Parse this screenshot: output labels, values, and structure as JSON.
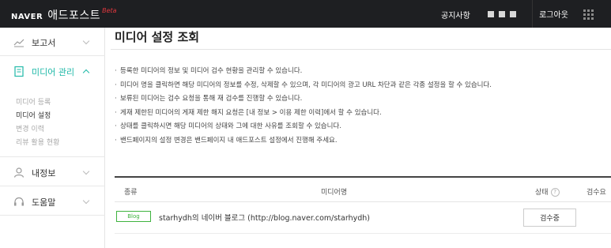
{
  "header": {
    "brand": "NAVER",
    "product": "애드포스트",
    "beta": "Beta",
    "notice": "공지사항",
    "logout": "로그아웃"
  },
  "sidebar": {
    "items": [
      {
        "label": "보고서",
        "icon": "chart-line-icon"
      },
      {
        "label": "미디어 관리",
        "icon": "media-doc-icon",
        "active": true
      },
      {
        "label": "내정보",
        "icon": "user-icon"
      },
      {
        "label": "도움말",
        "icon": "headset-icon"
      }
    ],
    "submenu": [
      "미디어 등록",
      "미디어 설정",
      "변경 이력",
      "리뷰 활용 현황"
    ]
  },
  "main": {
    "title": "미디어 설정 조회",
    "notes": [
      "등록한 미디어의 정보 및 미디어 검수 현황을 관리할 수 있습니다.",
      "미디어 명을 클릭하면 해당 미디어의 정보를 수정, 삭제할 수 있으며, 각 미디어의 광고 URL 차단과 같은 각종 설정을 할 수 있습니다.",
      "보류된 미디어는 검수 요청을 통해 재 검수를 진행할 수 있습니다.",
      "게재 제한된 미디어의 게재 제한 해지 요청은 [내 정보 > 이용 제한 이력]에서 할 수 있습니다.",
      "상태를 클릭하시면 해당 미디어의 상태와 그에 대한 사유를 조회할 수 있습니다.",
      "밴드페이지의 설정 변경은 밴드페이지 내 애드포스트 설정에서 진행해 주세요."
    ],
    "table": {
      "headers": {
        "type": "종류",
        "name": "미디어명",
        "status": "상태",
        "review": "검수요"
      },
      "help": "?",
      "rows": [
        {
          "type": "Blog",
          "name": "starhydh의 네이버 블로그 (http://blog.naver.com/starhydh)",
          "status": "검수중"
        }
      ]
    }
  },
  "colors": {
    "topbar": "#1e1f22",
    "accent": "#1db8a7",
    "blog": "#3fb33f"
  }
}
